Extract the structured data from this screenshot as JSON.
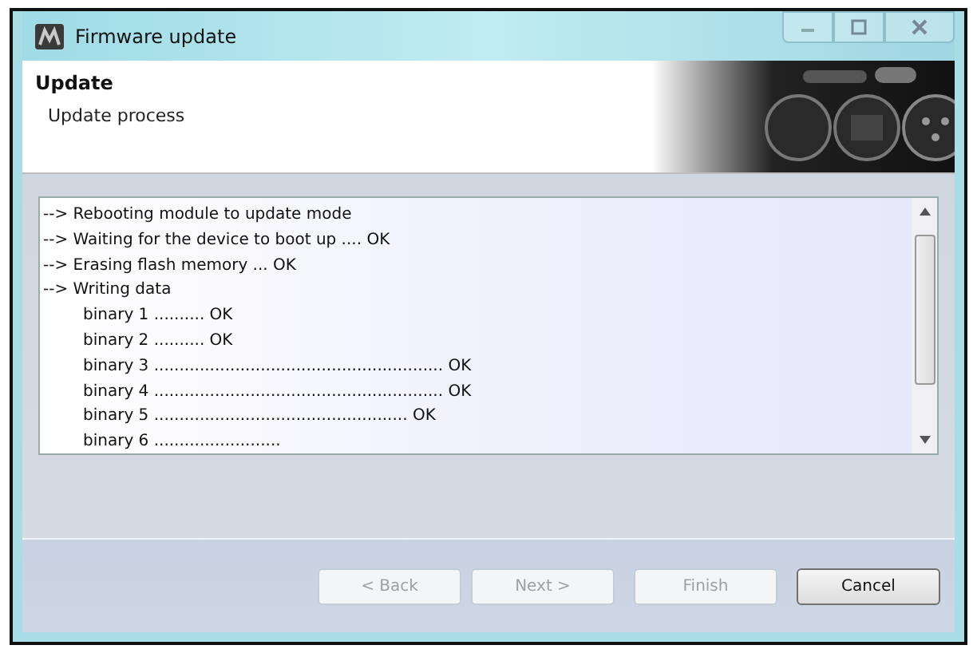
{
  "window": {
    "title": "Firmware update"
  },
  "header": {
    "title": "Update",
    "subtitle": "Update process"
  },
  "log": [
    {
      "kind": "step",
      "text": "--> Rebooting module to update mode"
    },
    {
      "kind": "step",
      "text": "--> Waiting for the device to boot up .... OK"
    },
    {
      "kind": "step",
      "text": "--> Erasing flash memory ... OK"
    },
    {
      "kind": "step",
      "text": "--> Writing data"
    },
    {
      "kind": "sub",
      "text": "binary 1 .......... OK"
    },
    {
      "kind": "sub",
      "text": "binary 2 .......... OK"
    },
    {
      "kind": "sub",
      "text": "binary 3 ......................................................... OK"
    },
    {
      "kind": "sub",
      "text": "binary 4 ......................................................... OK"
    },
    {
      "kind": "sub",
      "text": "binary 5 .................................................. OK"
    },
    {
      "kind": "sub",
      "text": "binary 6 ........................."
    }
  ],
  "buttons": [
    {
      "label": "< Back",
      "disabled": true
    },
    {
      "label": "Next >",
      "disabled": true
    },
    {
      "label": "Finish",
      "disabled": true
    },
    {
      "label": "Cancel",
      "disabled": false
    }
  ]
}
